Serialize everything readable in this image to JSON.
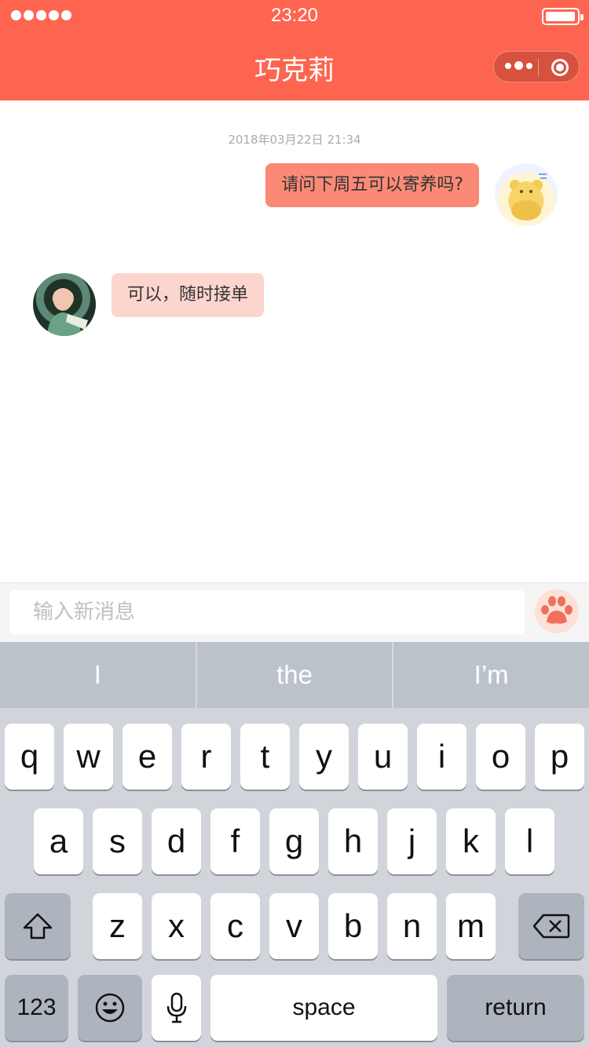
{
  "status_bar": {
    "time": "23:20"
  },
  "nav": {
    "title": "巧克莉",
    "menu_icon": "more-dots-icon",
    "close_icon": "target-circle-icon"
  },
  "colors": {
    "brand": "#fe6550",
    "my_bubble": "#fa8a76",
    "their_bubble": "#fdd5cf",
    "keyboard_bg": "#d1d5db"
  },
  "chat": {
    "timestamp": "2018年03月22日 21:34",
    "messages": [
      {
        "sender": "me",
        "text": "请问下周五可以寄养吗?"
      },
      {
        "sender": "contact",
        "text": "可以，随时接单"
      }
    ]
  },
  "composer": {
    "placeholder": "输入新消息",
    "value": "",
    "send_icon": "paw-icon"
  },
  "keyboard": {
    "suggestions": [
      "I",
      "the",
      "I’m"
    ],
    "row1": [
      "q",
      "w",
      "e",
      "r",
      "t",
      "y",
      "u",
      "i",
      "o",
      "p"
    ],
    "row2": [
      "a",
      "s",
      "d",
      "f",
      "g",
      "h",
      "j",
      "k",
      "l"
    ],
    "row3": [
      "z",
      "x",
      "c",
      "v",
      "b",
      "n",
      "m"
    ],
    "numbers_label": "123",
    "space_label": "space",
    "return_label": "return"
  }
}
